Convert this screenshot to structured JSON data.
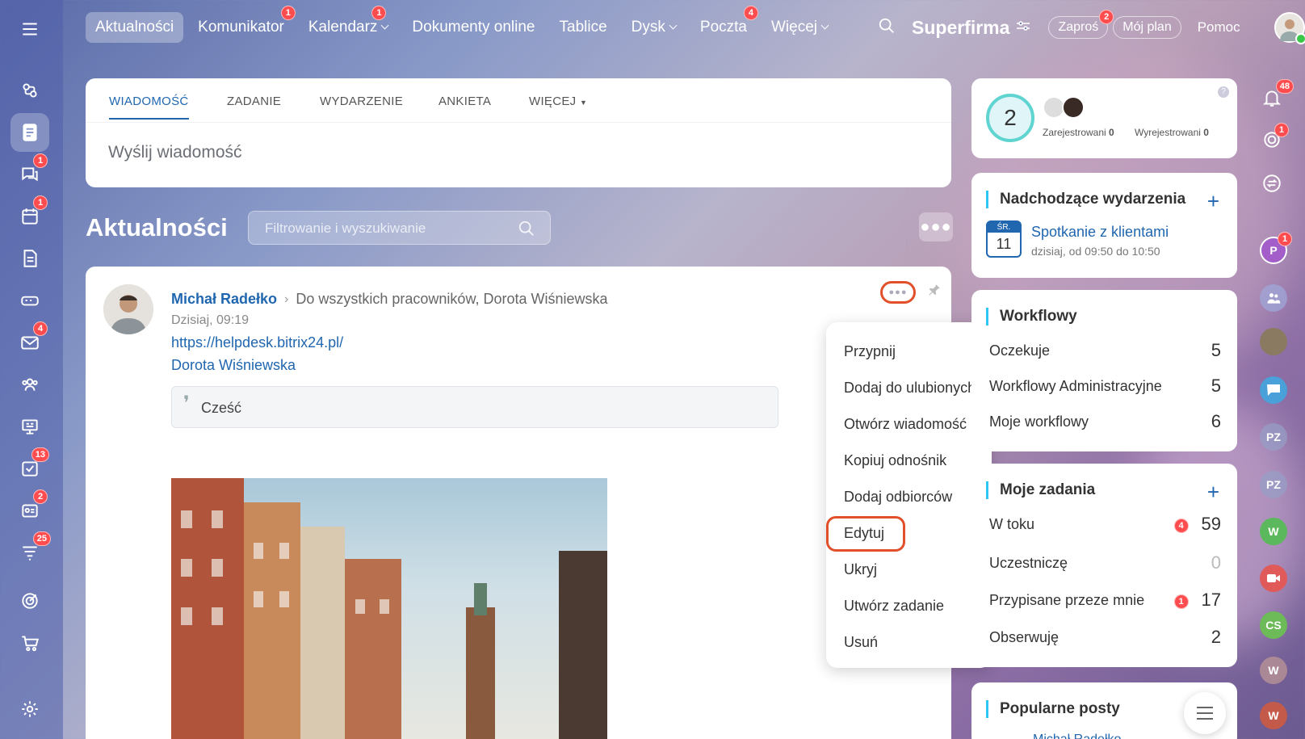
{
  "topnav": {
    "items": [
      {
        "label": "Aktualności",
        "active": true,
        "badge": "",
        "dropdown": false
      },
      {
        "label": "Komunikator",
        "badge": "1",
        "dropdown": false
      },
      {
        "label": "Kalendarz",
        "badge": "1",
        "dropdown": true
      },
      {
        "label": "Dokumenty online",
        "badge": "",
        "dropdown": false
      },
      {
        "label": "Tablice",
        "badge": "",
        "dropdown": false
      },
      {
        "label": "Dysk",
        "badge": "",
        "dropdown": true
      },
      {
        "label": "Poczta",
        "badge": "4",
        "dropdown": false
      },
      {
        "label": "Więcej",
        "badge": "",
        "dropdown": true
      }
    ],
    "company": "Superfirma",
    "invite": "Zaproś",
    "invite_badge": "2",
    "plan": "Mój plan",
    "help": "Pomoc"
  },
  "leftbar": {
    "badges": {
      "chat": "1",
      "calendar": "1",
      "mail": "4",
      "tasks": "13",
      "crm": "2",
      "filters": "25"
    }
  },
  "composer": {
    "tabs": [
      "WIADOMOŚĆ",
      "ZADANIE",
      "WYDARZENIE",
      "ANKIETA",
      "WIĘCEJ"
    ],
    "placeholder": "Wyślij wiadomość"
  },
  "feed": {
    "title": "Aktualności",
    "filter_placeholder": "Filtrowanie i wyszukiwanie",
    "post": {
      "author": "Michał Radełko",
      "recipients": "Do wszystkich pracowników, Dorota Wiśniewska",
      "time": "Dzisiaj, 09:19",
      "link": "https://helpdesk.bitrix24.pl/",
      "mention": "Dorota Wiśniewska",
      "quote": "Cześć"
    }
  },
  "menu": {
    "items": [
      "Przypnij",
      "Dodaj do ulubionych",
      "Otwórz wiadomość",
      "Kopiuj odnośnik",
      "Dodaj odbiorców",
      "Edytuj",
      "Ukryj",
      "Utwórz zadanie",
      "Usuń"
    ],
    "highlighted": "Edytuj"
  },
  "presence": {
    "count": "2",
    "registered_label": "Zarejestrowani",
    "registered": "0",
    "unregistered_label": "Wyrejestrowani",
    "unregistered": "0"
  },
  "events": {
    "title": "Nadchodzące wydarzenia",
    "day_name": "ŚR.",
    "day": "11",
    "name": "Spotkanie z klientami",
    "time": "dzisiaj, od 09:50 do 10:50"
  },
  "workflows": {
    "title": "Workflowy",
    "rows": [
      {
        "label": "Oczekuje",
        "value": "5"
      },
      {
        "label": "Workflowy Administracyjne",
        "value": "5"
      },
      {
        "label": "Moje workflowy",
        "value": "6"
      }
    ]
  },
  "tasks": {
    "title": "Moje zadania",
    "rows": [
      {
        "label": "W toku",
        "badge": "4",
        "value": "59"
      },
      {
        "label": "Uczestniczę",
        "badge": "",
        "value": "0"
      },
      {
        "label": "Przypisane przeze mnie",
        "badge": "1",
        "value": "17"
      },
      {
        "label": "Obserwuję",
        "badge": "",
        "value": "2"
      }
    ]
  },
  "popular": {
    "title": "Popularne posty",
    "author": "Michał Radełko"
  },
  "rightbar": {
    "notif_badge": "48",
    "goal_badge": "1",
    "p_badge": "1",
    "avatars": [
      "P",
      "PZ",
      "PZ",
      "W",
      "CS",
      "W",
      "W"
    ]
  },
  "colors": {
    "accent": "#2067b0",
    "badge": "#ff4d4f",
    "highlight": "#e2502b"
  }
}
